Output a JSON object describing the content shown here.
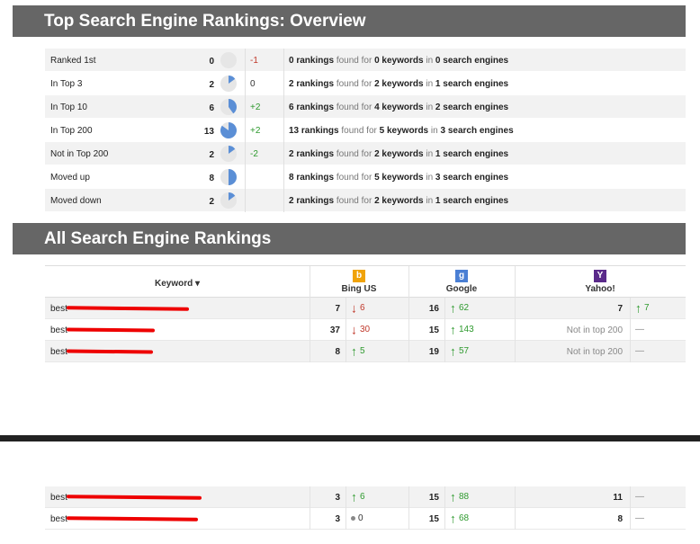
{
  "overview": {
    "title": "Top Search Engine Rankings: Overview",
    "rows": [
      {
        "label": "Ranked 1st",
        "count": "0",
        "change": "-1",
        "change_type": "neg",
        "pie": 0,
        "rankings": "0 rankings",
        "keywords": "0 keywords",
        "engines": "0 search engines"
      },
      {
        "label": "In Top 3",
        "count": "2",
        "change": "0",
        "change_type": "zero",
        "pie": 0.15,
        "rankings": "2 rankings",
        "keywords": "2 keywords",
        "engines": "1 search engines"
      },
      {
        "label": "In Top 10",
        "count": "6",
        "change": "+2",
        "change_type": "pos",
        "pie": 0.4,
        "rankings": "6 rankings",
        "keywords": "4 keywords",
        "engines": "2 search engines"
      },
      {
        "label": "In Top 200",
        "count": "13",
        "change": "+2",
        "change_type": "pos",
        "pie": 0.85,
        "rankings": "13 rankings",
        "keywords": "5 keywords",
        "engines": "3 search engines"
      },
      {
        "label": "Not in Top 200",
        "count": "2",
        "change": "-2",
        "change_type": "pos",
        "pie": 0.15,
        "rankings": "2 rankings",
        "keywords": "2 keywords",
        "engines": "1 search engines"
      },
      {
        "label": "Moved up",
        "count": "8",
        "change": "",
        "change_type": "zero",
        "pie": 0.5,
        "rankings": "8 rankings",
        "keywords": "5 keywords",
        "engines": "3 search engines"
      },
      {
        "label": "Moved down",
        "count": "2",
        "change": "",
        "change_type": "zero",
        "pie": 0.15,
        "rankings": "2 rankings",
        "keywords": "2 keywords",
        "engines": "1 search engines"
      }
    ],
    "found_for": "found for",
    "in": "in"
  },
  "all_rankings": {
    "title": "All Search Engine Rankings",
    "keyword_header": "Keyword ▾",
    "engines": [
      {
        "name": "Bing US",
        "logo": "b",
        "color": "#f0a30a"
      },
      {
        "name": "Google",
        "logo": "g",
        "color": "#4a7fd4"
      },
      {
        "name": "Yahoo!",
        "logo": "Y",
        "color": "#5a2a8a"
      }
    ],
    "rows": [
      {
        "keyword": "best",
        "bing_pos": "7",
        "bing_dir": "down",
        "bing_chg": "6",
        "google_pos": "16",
        "google_dir": "up",
        "google_chg": "62",
        "yahoo_pos": "7",
        "yahoo_dir": "up",
        "yahoo_chg": "7"
      },
      {
        "keyword": "best",
        "bing_pos": "37",
        "bing_dir": "down",
        "bing_chg": "30",
        "google_pos": "15",
        "google_dir": "up",
        "google_chg": "143",
        "yahoo_pos": "Not in top 200",
        "yahoo_dir": "dash",
        "yahoo_chg": ""
      },
      {
        "keyword": "best",
        "bing_pos": "8",
        "bing_dir": "up",
        "bing_chg": "5",
        "google_pos": "19",
        "google_dir": "up",
        "google_chg": "57",
        "yahoo_pos": "Not in top 200",
        "yahoo_dir": "dash",
        "yahoo_chg": ""
      }
    ],
    "rows_lower": [
      {
        "keyword": "best",
        "bing_pos": "3",
        "bing_dir": "up",
        "bing_chg": "6",
        "google_pos": "15",
        "google_dir": "up",
        "google_chg": "88",
        "yahoo_pos": "11",
        "yahoo_dir": "dash",
        "yahoo_chg": ""
      },
      {
        "keyword": "best",
        "bing_pos": "3",
        "bing_dir": "dot",
        "bing_chg": "0",
        "google_pos": "15",
        "google_dir": "up",
        "google_chg": "68",
        "yahoo_pos": "8",
        "yahoo_dir": "dash",
        "yahoo_chg": ""
      }
    ]
  },
  "colors": {
    "header_bg": "#666666",
    "pie_fill": "#5b8fd6",
    "pie_bg": "#e6e6e6",
    "up": "#2e9a2e",
    "down": "#c0392b",
    "redaction": "#ee0000"
  }
}
